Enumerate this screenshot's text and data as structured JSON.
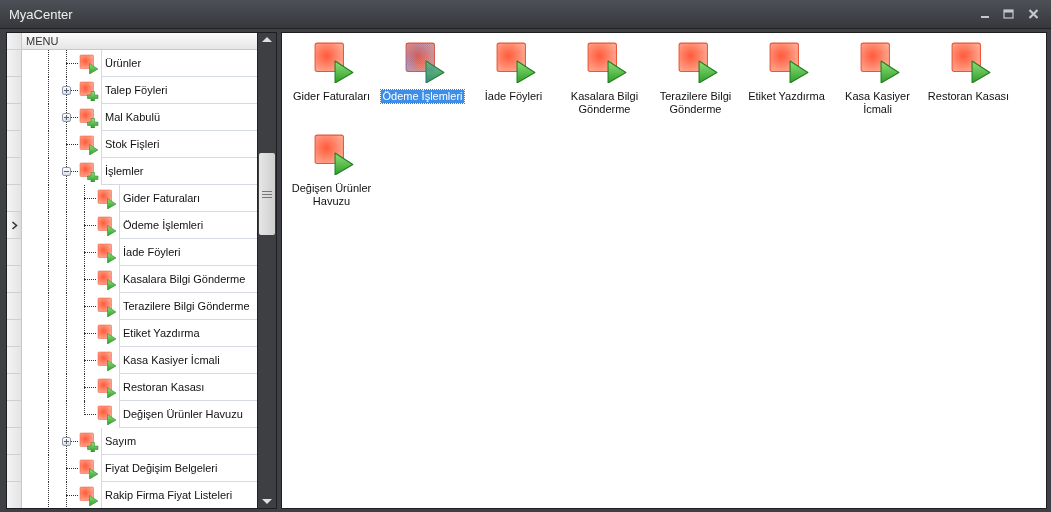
{
  "window": {
    "title": "MyaCenter"
  },
  "menu": {
    "header": "MENU",
    "items": [
      {
        "label": "Ürünler",
        "kind": "item",
        "selected": false
      },
      {
        "label": "Talep Föyleri",
        "kind": "group",
        "expanded": false,
        "selected": false
      },
      {
        "label": "Mal Kabulü",
        "kind": "group",
        "expanded": false,
        "selected": false
      },
      {
        "label": "Stok Fişleri",
        "kind": "item",
        "selected": false
      },
      {
        "label": "İşlemler",
        "kind": "group",
        "expanded": true,
        "selected": false,
        "children": [
          {
            "label": "Gider Faturaları",
            "kind": "item",
            "selected": false
          },
          {
            "label": "Ödeme İşlemleri",
            "kind": "item",
            "selected": true
          },
          {
            "label": "İade Föyleri",
            "kind": "item",
            "selected": false
          },
          {
            "label": "Kasalara Bilgi Gönderme",
            "kind": "item",
            "selected": false
          },
          {
            "label": "Terazilere Bilgi Gönderme",
            "kind": "item",
            "selected": false
          },
          {
            "label": "Etiket Yazdırma",
            "kind": "item",
            "selected": false
          },
          {
            "label": "Kasa Kasiyer İcmali",
            "kind": "item",
            "selected": false
          },
          {
            "label": "Restoran Kasası",
            "kind": "item",
            "selected": false
          },
          {
            "label": "Değişen Ürünler Havuzu",
            "kind": "item",
            "selected": false
          }
        ]
      },
      {
        "label": "Sayım",
        "kind": "group",
        "expanded": false,
        "selected": false
      },
      {
        "label": "Fiyat Değişim Belgeleri",
        "kind": "item",
        "selected": false
      },
      {
        "label": "Rakip Firma Fiyat Listeleri",
        "kind": "item",
        "selected": false
      }
    ]
  },
  "content": {
    "items": [
      {
        "label": "Gider Faturaları",
        "selected": false
      },
      {
        "label": "Ödeme İşlemleri",
        "selected": true
      },
      {
        "label": "İade Föyleri",
        "selected": false
      },
      {
        "label": "Kasalara Bilgi Gönderme",
        "selected": false
      },
      {
        "label": "Terazilere Bilgi Gönderme",
        "selected": false
      },
      {
        "label": "Etiket Yazdırma",
        "selected": false
      },
      {
        "label": "Kasa Kasiyer İcmali",
        "selected": false
      },
      {
        "label": "Restoran Kasası",
        "selected": false
      },
      {
        "label": "Değişen Ürünler Havuzu",
        "selected": false
      }
    ]
  }
}
